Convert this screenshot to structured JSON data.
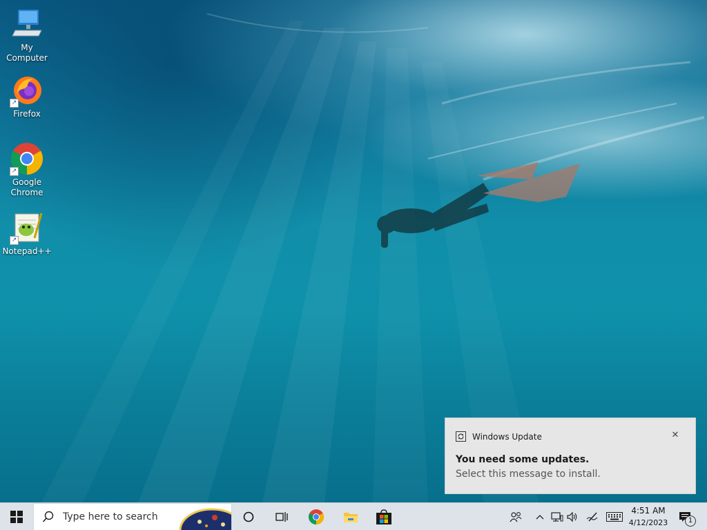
{
  "desktop": {
    "icons": [
      {
        "label": "My Computer",
        "icon": "computer-icon"
      },
      {
        "label": "Firefox",
        "icon": "firefox-icon"
      },
      {
        "label": "Google Chrome",
        "icon": "chrome-icon"
      },
      {
        "label": "Notepad++",
        "icon": "notepad-plus-plus-icon"
      }
    ]
  },
  "notification": {
    "app": "Windows Update",
    "title": "You need some updates.",
    "message": "Select this message to install.",
    "icon": "refresh-icon",
    "close_icon": "close-icon"
  },
  "taskbar": {
    "search_placeholder": "Type here to search",
    "pinned": [
      "chrome-icon",
      "file-explorer-icon",
      "microsoft-store-icon"
    ],
    "clock": {
      "time": "4:51 AM",
      "date": "4/12/2023"
    },
    "notification_count": "1"
  },
  "colors": {
    "taskbar_bg": "#dde3e8",
    "toast_bg": "#e6e6e6",
    "water": "#118ea9"
  }
}
